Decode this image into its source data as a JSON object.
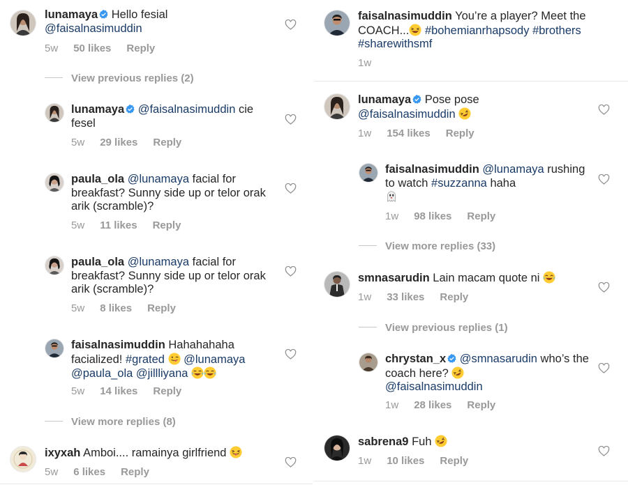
{
  "colors": {
    "text": "#262626",
    "muted": "#999999",
    "link": "#1a3b67",
    "verified": "#3897f0",
    "separator": "#f2f2f2"
  },
  "icons": {
    "like": "heart-icon",
    "verified": "verified-badge-icon"
  },
  "left_column": {
    "c1": {
      "username": "lunamaya",
      "text": "Hello fesial",
      "mention": "@faisalnasimuddin",
      "time": "5w",
      "likes": "50 likes",
      "reply": "Reply"
    },
    "thread1": "View previous replies (2)",
    "r1": {
      "username": "lunamaya",
      "mention": "@faisalnasimuddin",
      "text": "cie fesel",
      "time": "5w",
      "likes": "29 likes",
      "reply": "Reply"
    },
    "r2": {
      "username": "paula_ola",
      "mention": "@lunamaya",
      "text": "facial for breakfast? Sunny side up or telor orak arik (scramble)?",
      "time": "5w",
      "likes": "11 likes",
      "reply": "Reply"
    },
    "r3": {
      "username": "paula_ola",
      "mention": "@lunamaya",
      "text": "facial for breakfast? Sunny side up or telor orak arik (scramble)?",
      "time": "5w",
      "likes": "8 likes",
      "reply": "Reply"
    },
    "r4": {
      "username": "faisalnasimuddin",
      "text": "Hahahahaha facialized!",
      "hashtag": "#grated",
      "mention1": "@lunamaya",
      "mention2": "@paula_ola",
      "mention3": "@jillliyana",
      "time": "5w",
      "likes": "14 likes",
      "reply": "Reply"
    },
    "thread2": "View more replies (8)",
    "c2": {
      "username": "ixyxah",
      "text": "Amboi.... ramainya girlfriend",
      "time": "5w",
      "likes": "6 likes",
      "reply": "Reply"
    }
  },
  "right_column": {
    "c1": {
      "username": "faisalnasimuddin",
      "text": "You’re a player? Meet the COACH...",
      "hashtag1": "#bohemianrhapsody",
      "hashtag2": "#brothers",
      "hashtag3": "#sharewithsmf",
      "time": "1w"
    },
    "c2": {
      "username": "lunamaya",
      "text": "Pose pose",
      "mention": "@faisalnasimuddin",
      "time": "1w",
      "likes": "154 likes",
      "reply": "Reply"
    },
    "r1": {
      "username": "faisalnasimuddin",
      "mention": "@lunamaya",
      "text": "rushing to watch",
      "hashtag": "#suzzanna",
      "text2": "haha",
      "time": "1w",
      "likes": "98 likes",
      "reply": "Reply"
    },
    "thread1": "View more replies (33)",
    "c3": {
      "username": "smnasarudin",
      "text": "Lain macam quote ni",
      "time": "1w",
      "likes": "33 likes",
      "reply": "Reply"
    },
    "thread2": "View previous replies (1)",
    "r2": {
      "username": "chrystan_x",
      "mention": "@smnasarudin",
      "text": "who’s the coach here?",
      "mention2": "@faisalnasimuddin",
      "time": "1w",
      "likes": "28 likes",
      "reply": "Reply"
    },
    "c4": {
      "username": "sabrena9",
      "text": "Fuh",
      "time": "1w",
      "likes": "10 likes",
      "reply": "Reply"
    }
  }
}
